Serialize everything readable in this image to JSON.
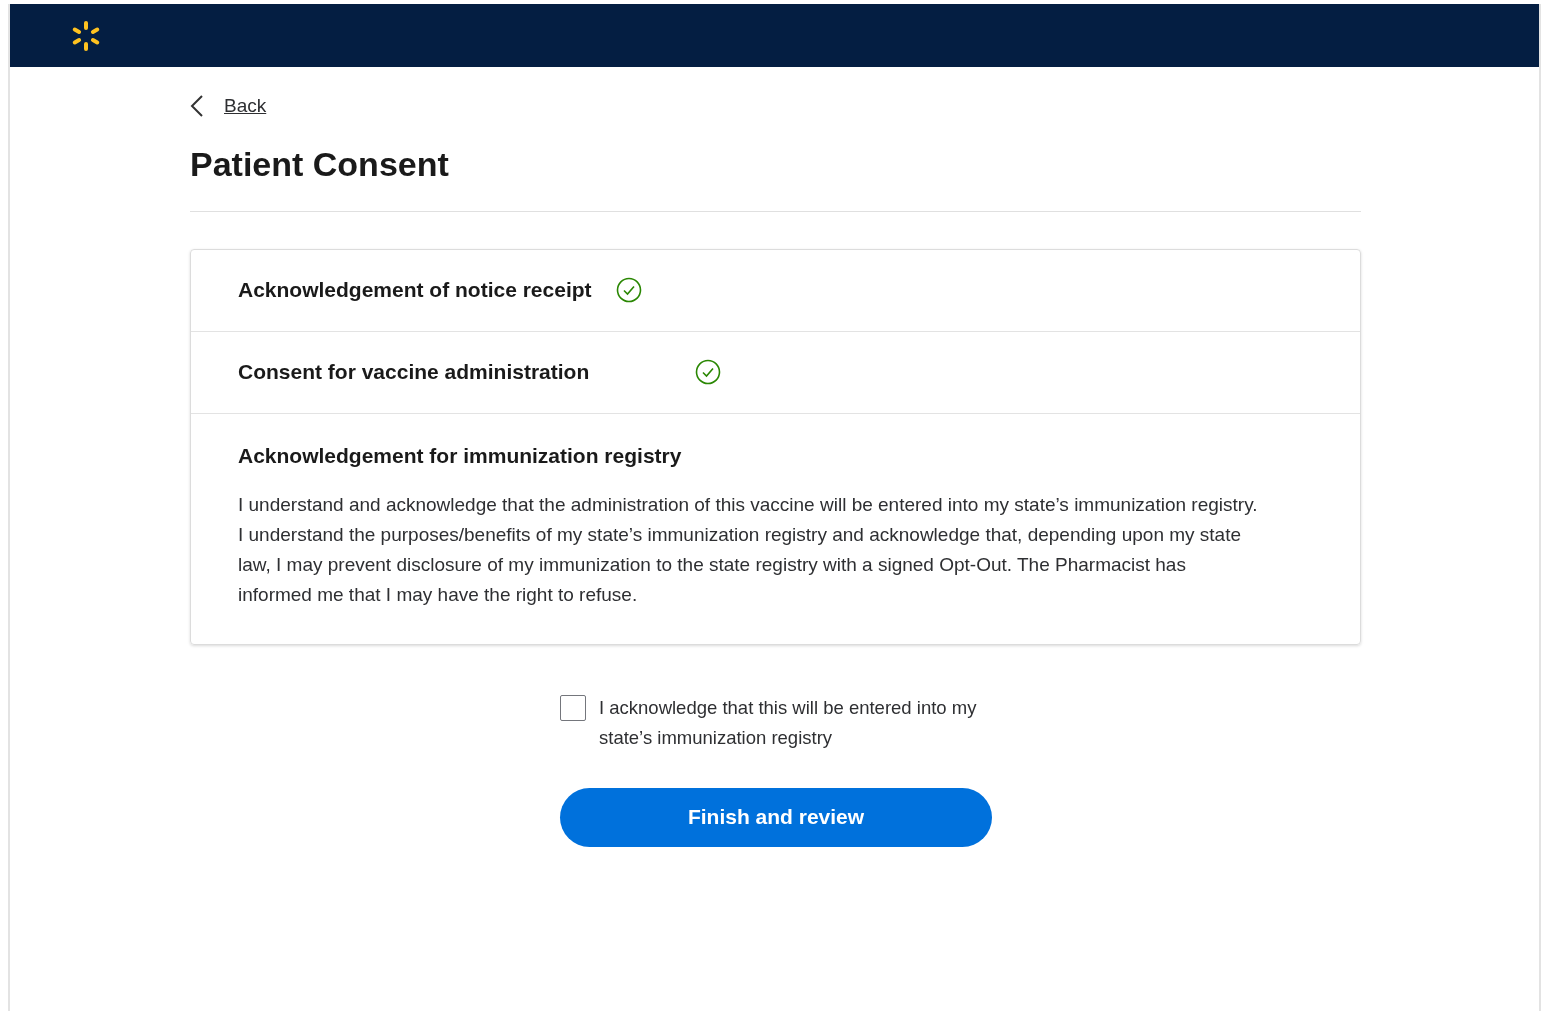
{
  "back_link": "Back",
  "title": "Patient Consent",
  "sections": [
    {
      "title": "Acknowledgement of notice receipt",
      "completed": true
    },
    {
      "title": "Consent for vaccine administration",
      "completed": true
    },
    {
      "title": "Acknowledgement for immunization registry",
      "completed": false,
      "body": "I understand and acknowledge that the administration of this vaccine will be entered into my state’s immunization registry. I understand the purposes/benefits of my state’s immunization registry and acknowledge that, depending upon my state law, I may prevent disclosure of my immunization to the state registry with a signed Opt-Out. The Pharmacist has informed me that I may have the right to refuse."
    }
  ],
  "acknowledge": {
    "label": "I acknowledge that this will be entered into my state’s immunization registry",
    "checked": false
  },
  "button": "Finish and review"
}
